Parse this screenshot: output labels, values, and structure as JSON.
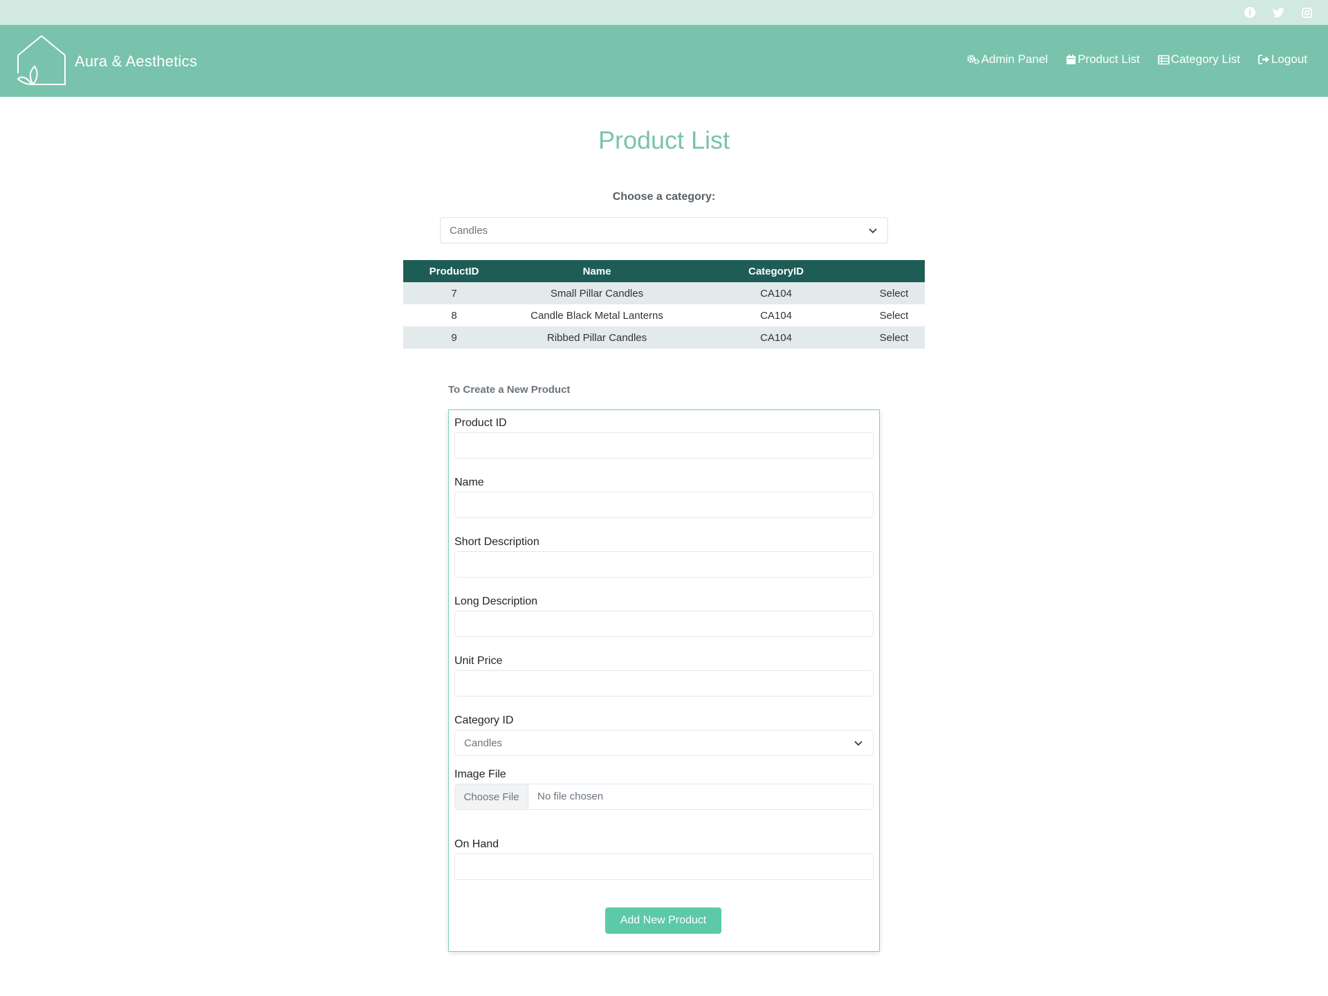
{
  "topbar": {
    "social_icons": [
      "facebook-icon",
      "twitter-icon",
      "instagram-icon"
    ]
  },
  "brand": {
    "name": "Aura & Aesthetics",
    "logo": "house-leaf-logo"
  },
  "nav": {
    "items": [
      {
        "label": "Admin Panel",
        "icon": "gears-icon"
      },
      {
        "label": "Product List",
        "icon": "calendar-icon"
      },
      {
        "label": "Category List",
        "icon": "table-list-icon"
      },
      {
        "label": "Logout",
        "icon": "logout-icon"
      }
    ]
  },
  "page": {
    "title": "Product List"
  },
  "filter": {
    "label": "Choose a category:",
    "selected": "Candles"
  },
  "table": {
    "headers": [
      "ProductID",
      "Name",
      "CategoryID",
      ""
    ],
    "rows": [
      {
        "id": "7",
        "name": "Small Pillar Candles",
        "category": "CA104",
        "action": "Select"
      },
      {
        "id": "8",
        "name": "Candle Black Metal Lanterns",
        "category": "CA104",
        "action": "Select"
      },
      {
        "id": "9",
        "name": "Ribbed Pillar Candles",
        "category": "CA104",
        "action": "Select"
      }
    ]
  },
  "form": {
    "heading": "To Create a New Product",
    "fields": {
      "product_id": {
        "label": "Product ID",
        "value": ""
      },
      "name": {
        "label": "Name",
        "value": ""
      },
      "short_description": {
        "label": "Short Description",
        "value": ""
      },
      "long_description": {
        "label": "Long Description",
        "value": ""
      },
      "unit_price": {
        "label": "Unit Price",
        "value": ""
      },
      "category_id": {
        "label": "Category ID",
        "selected": "Candles"
      },
      "image_file": {
        "label": "Image File",
        "button": "Choose File",
        "status": "No file chosen"
      },
      "on_hand": {
        "label": "On Hand",
        "value": ""
      }
    },
    "submit_label": "Add New Product"
  },
  "colors": {
    "topbar": "#d1e9e1",
    "navbar": "#79c3ac",
    "title": "#79c3ac",
    "table_header": "#1e5d55",
    "row_stripe": "#e3eaec",
    "button": "#5cc9a7",
    "form_border": "#79d1b4"
  }
}
